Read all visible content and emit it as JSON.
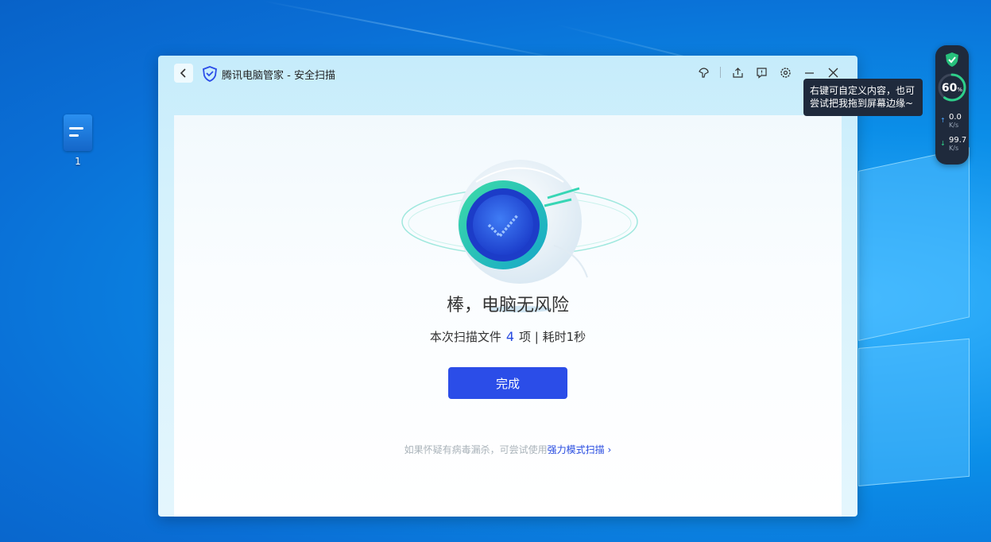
{
  "desktop": {
    "icon_label": "1"
  },
  "window": {
    "title": "腾讯电脑管家 - 安全扫描",
    "accent_color": "#2b4de8"
  },
  "toolbar": {
    "icons": [
      "skin-icon",
      "share-icon",
      "feedback-icon",
      "settings-icon",
      "minimize-icon",
      "close-icon"
    ]
  },
  "result": {
    "headline": "棒，电脑无风险",
    "stats_prefix": "本次扫描文件",
    "file_count": "4",
    "stats_suffix": "项 | 耗时1秒",
    "done_button": "完成",
    "hint_text": "如果怀疑有病毒漏杀，可尝试使用",
    "hint_link": "强力模式扫描",
    "hint_chevron": "›"
  },
  "widget": {
    "percent": "60",
    "percent_unit": "%",
    "percent_fraction": 0.6,
    "upload_value": "0.0",
    "upload_unit": "K/s",
    "download_value": "99.7",
    "download_unit": "K/s",
    "tooltip": "右键可自定义内容，也可尝试把我拖到屏幕边缘~"
  }
}
